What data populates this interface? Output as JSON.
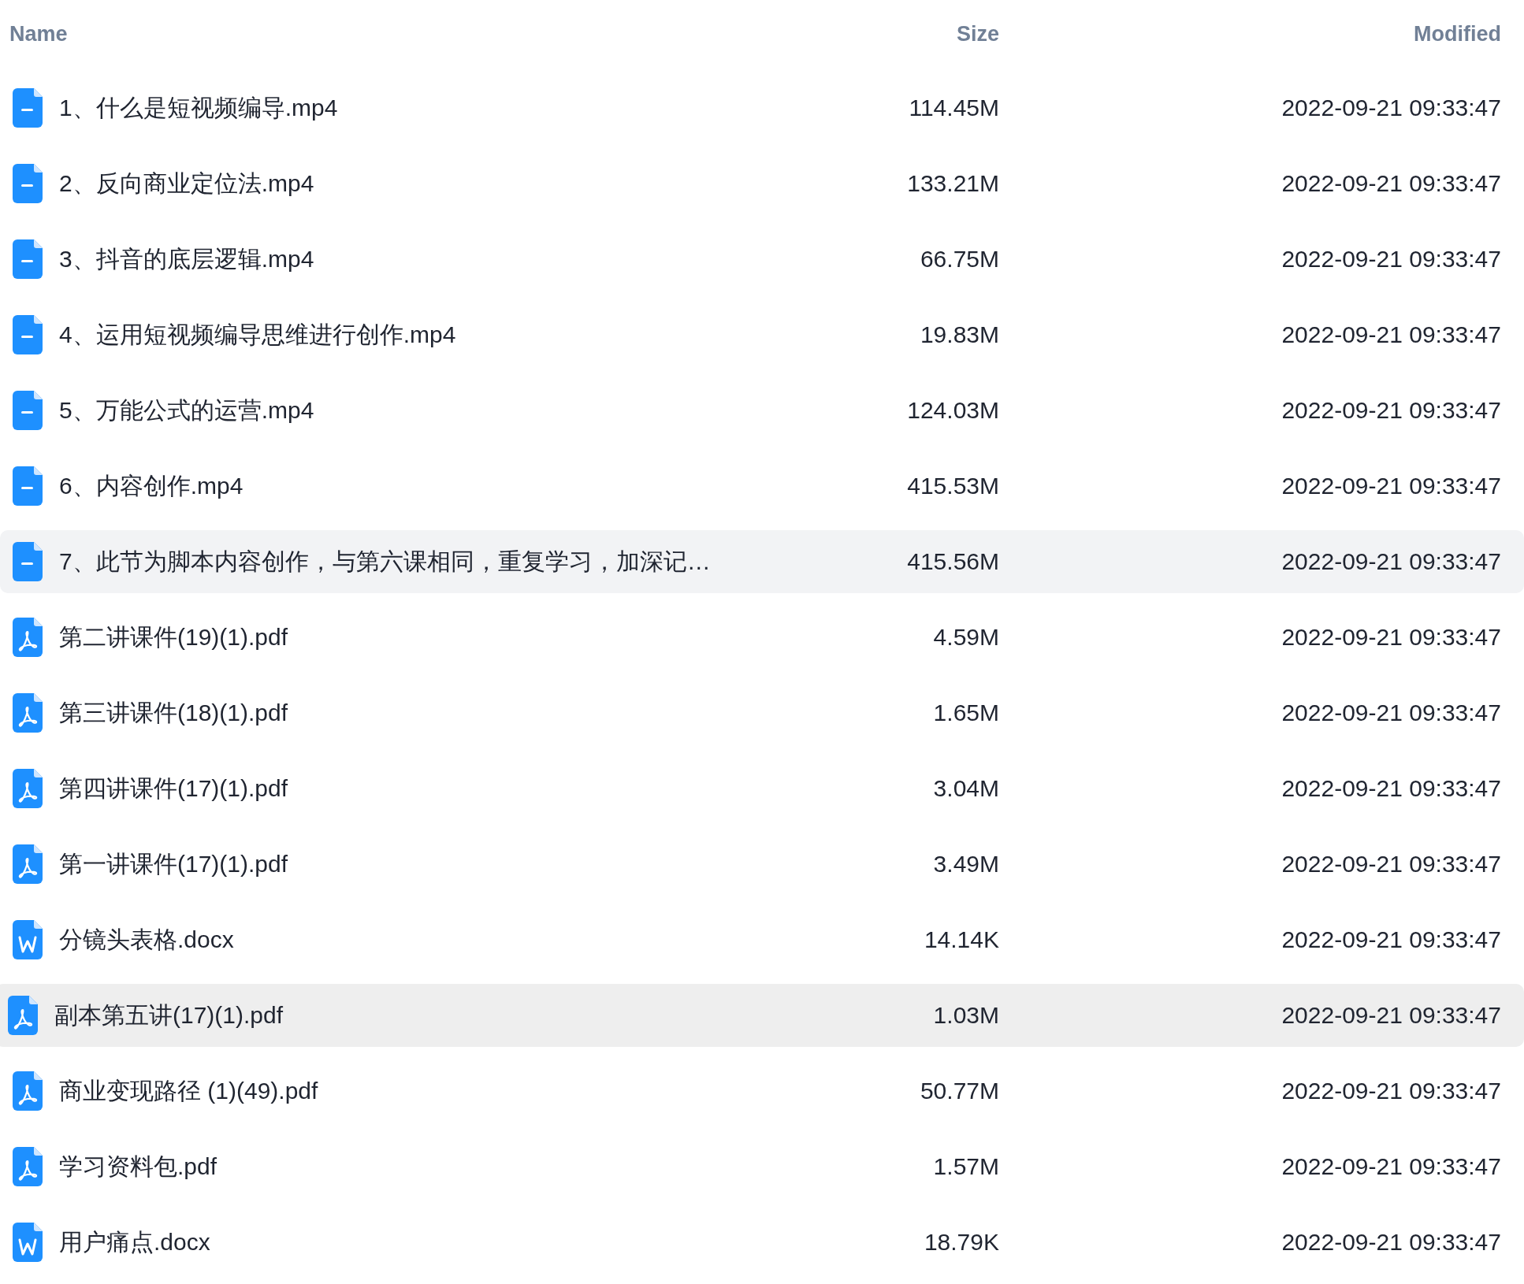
{
  "columns": [
    {
      "label": "Name"
    },
    {
      "label": "Size"
    },
    {
      "label": "Modified"
    }
  ],
  "files": [
    {
      "kind": "video",
      "name": "1、什么是短视频编导.mp4",
      "size": "114.45M",
      "modified": "2022-09-21 09:33:47",
      "hovered": false,
      "selected": false
    },
    {
      "kind": "video",
      "name": "2、反向商业定位法.mp4",
      "size": "133.21M",
      "modified": "2022-09-21 09:33:47",
      "hovered": false,
      "selected": false
    },
    {
      "kind": "video",
      "name": "3、抖音的底层逻辑.mp4",
      "size": "66.75M",
      "modified": "2022-09-21 09:33:47",
      "hovered": false,
      "selected": false
    },
    {
      "kind": "video",
      "name": "4、运用短视频编导思维进行创作.mp4",
      "size": "19.83M",
      "modified": "2022-09-21 09:33:47",
      "hovered": false,
      "selected": false
    },
    {
      "kind": "video",
      "name": "5、万能公式的运营.mp4",
      "size": "124.03M",
      "modified": "2022-09-21 09:33:47",
      "hovered": false,
      "selected": false
    },
    {
      "kind": "video",
      "name": "6、内容创作.mp4",
      "size": "415.53M",
      "modified": "2022-09-21 09:33:47",
      "hovered": false,
      "selected": false
    },
    {
      "kind": "video",
      "name": "7、此节为脚本内容创作，与第六课相同，重复学习，加深记…",
      "size": "415.56M",
      "modified": "2022-09-21 09:33:47",
      "hovered": true,
      "selected": false
    },
    {
      "kind": "pdf",
      "name": "第二讲课件(19)(1).pdf",
      "size": "4.59M",
      "modified": "2022-09-21 09:33:47",
      "hovered": false,
      "selected": false
    },
    {
      "kind": "pdf",
      "name": "第三讲课件(18)(1).pdf",
      "size": "1.65M",
      "modified": "2022-09-21 09:33:47",
      "hovered": false,
      "selected": false
    },
    {
      "kind": "pdf",
      "name": "第四讲课件(17)(1).pdf",
      "size": "3.04M",
      "modified": "2022-09-21 09:33:47",
      "hovered": false,
      "selected": false
    },
    {
      "kind": "pdf",
      "name": "第一讲课件(17)(1).pdf",
      "size": "3.49M",
      "modified": "2022-09-21 09:33:47",
      "hovered": false,
      "selected": false
    },
    {
      "kind": "word",
      "name": "分镜头表格.docx",
      "size": "14.14K",
      "modified": "2022-09-21 09:33:47",
      "hovered": false,
      "selected": false
    },
    {
      "kind": "pdf",
      "name": "副本第五讲(17)(1).pdf",
      "size": "1.03M",
      "modified": "2022-09-21 09:33:47",
      "hovered": false,
      "selected": true
    },
    {
      "kind": "pdf",
      "name": "商业变现路径 (1)(49).pdf",
      "size": "50.77M",
      "modified": "2022-09-21 09:33:47",
      "hovered": false,
      "selected": false
    },
    {
      "kind": "pdf",
      "name": "学习资料包.pdf",
      "size": "1.57M",
      "modified": "2022-09-21 09:33:47",
      "hovered": false,
      "selected": false
    },
    {
      "kind": "word",
      "name": "用户痛点.docx",
      "size": "18.79K",
      "modified": "2022-09-21 09:33:47",
      "hovered": false,
      "selected": false
    }
  ]
}
